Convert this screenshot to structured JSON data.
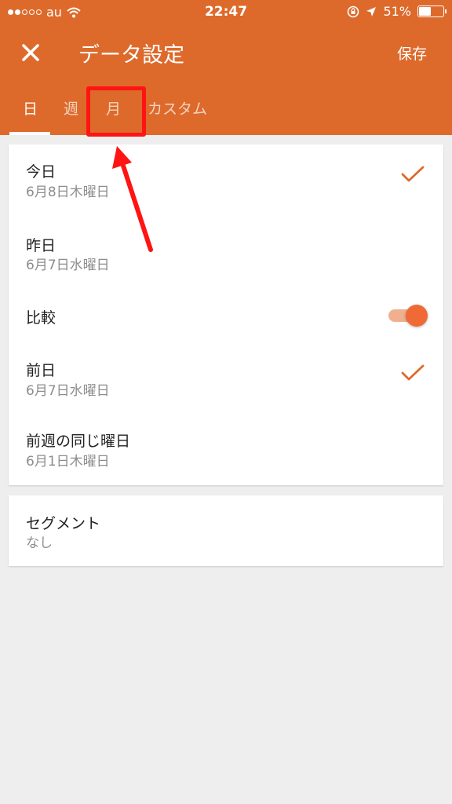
{
  "status_bar": {
    "carrier": "au",
    "time": "22:47",
    "battery_percent": "51%",
    "battery_level": 0.51,
    "signal_dots_filled": 2,
    "signal_dots_total": 5
  },
  "header": {
    "title": "データ設定",
    "save_label": "保存",
    "color": "#dd6a2b"
  },
  "tabs": [
    {
      "label": "日",
      "selected": true
    },
    {
      "label": "週",
      "selected": false
    },
    {
      "label": "月",
      "selected": false
    },
    {
      "label": "カスタム",
      "selected": false
    }
  ],
  "primary_range": [
    {
      "label": "今日",
      "date": "6月8日木曜日",
      "checked": true
    },
    {
      "label": "昨日",
      "date": "6月7日水曜日",
      "checked": false
    }
  ],
  "compare": {
    "label": "比較",
    "enabled": true
  },
  "compare_range": [
    {
      "label": "前日",
      "date": "6月7日水曜日",
      "checked": true
    },
    {
      "label": "前週の同じ曜日",
      "date": "6月1日木曜日",
      "checked": false
    }
  ],
  "segment": {
    "label": "セグメント",
    "value": "なし"
  },
  "annotation": {
    "color": "#ff1414"
  }
}
